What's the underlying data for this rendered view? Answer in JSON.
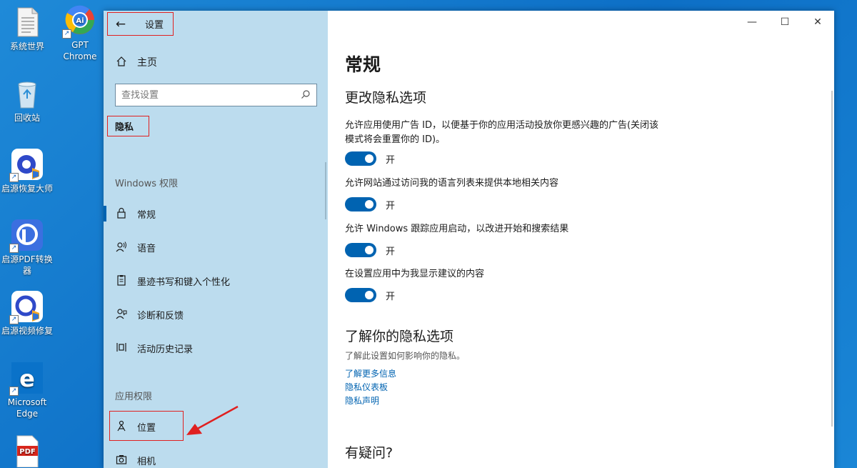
{
  "desktop": {
    "icons": [
      {
        "label": "系统世界"
      },
      {
        "label": "GPT Chrome"
      },
      {
        "label": "回收站"
      },
      {
        "label": "启源恢复大师"
      },
      {
        "label": "启源PDF转换器"
      },
      {
        "label": "启源视频修复"
      },
      {
        "label": "Microsoft Edge"
      },
      {
        "label": "PDF"
      }
    ]
  },
  "window": {
    "title": "设置",
    "controls": {
      "minimize": "—",
      "maximize": "☐",
      "close": "✕"
    }
  },
  "sidebar": {
    "home": "主页",
    "search_placeholder": "查找设置",
    "section": "隐私",
    "group_windows": "Windows 权限",
    "group_app": "应用权限",
    "items": [
      {
        "label": "常规",
        "icon": "lock-icon"
      },
      {
        "label": "语音",
        "icon": "speech-icon"
      },
      {
        "label": "墨迹书写和键入个性化",
        "icon": "clipboard-icon"
      },
      {
        "label": "诊断和反馈",
        "icon": "feedback-icon"
      },
      {
        "label": "活动历史记录",
        "icon": "timeline-icon"
      },
      {
        "label": "位置",
        "icon": "location-icon"
      },
      {
        "label": "相机",
        "icon": "camera-icon"
      }
    ]
  },
  "main": {
    "title": "常规",
    "section1": "更改隐私选项",
    "options": [
      {
        "text": "允许应用使用广告 ID，以便基于你的应用活动投放你更感兴趣的广告(关闭该模式将会重置你的 ID)。",
        "state": "开"
      },
      {
        "text": "允许网站通过访问我的语言列表来提供本地相关内容",
        "state": "开"
      },
      {
        "text": "允许 Windows 跟踪应用启动，以改进开始和搜索结果",
        "state": "开"
      },
      {
        "text": "在设置应用中为我显示建议的内容",
        "state": "开"
      }
    ],
    "section2": "了解你的隐私选项",
    "section2_desc": "了解此设置如何影响你的隐私。",
    "links": [
      "了解更多信息",
      "隐私仪表板",
      "隐私声明"
    ],
    "section3": "有疑问?"
  },
  "colors": {
    "accent": "#0063b1",
    "sidebar_bg": "#bcdcee",
    "highlight": "#e02020"
  }
}
